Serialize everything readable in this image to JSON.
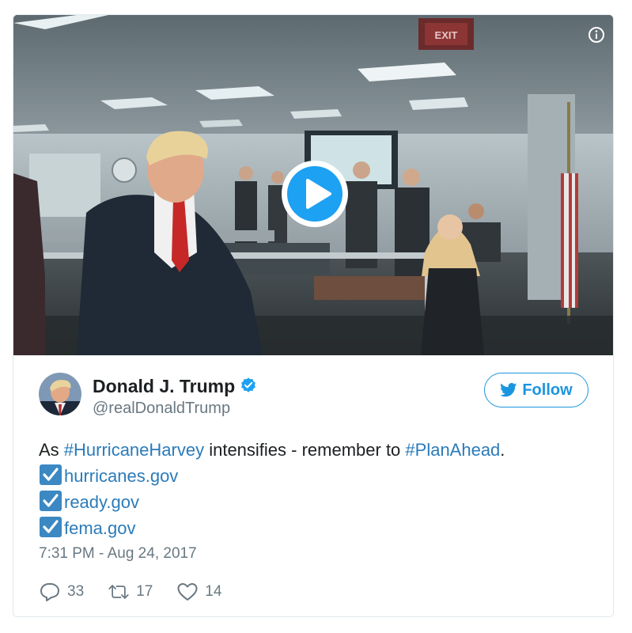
{
  "media": {
    "exit_sign": "EXIT",
    "info_icon": "info-icon",
    "play_icon": "play-icon"
  },
  "author": {
    "name": "Donald J. Trump",
    "handle": "@realDonaldTrump",
    "verified_icon": "verified-badge-icon",
    "follow_label": "Follow"
  },
  "tweet": {
    "lead_text": "As ",
    "hashtag1": "#HurricaneHarvey",
    "middle_text": " intensifies - remember to ",
    "hashtag2": "#PlanAhead",
    "end_text": ".",
    "links": [
      "hurricanes.gov",
      "ready.gov",
      "fema.gov"
    ],
    "timestamp": "7:31 PM - Aug 24, 2017"
  },
  "actions": {
    "replies": "33",
    "retweets": "17",
    "likes": "14"
  },
  "colors": {
    "link": "#2b7bb9",
    "brand": "#1b95e0",
    "meta": "#697882",
    "check_box": "#3b88c3"
  }
}
